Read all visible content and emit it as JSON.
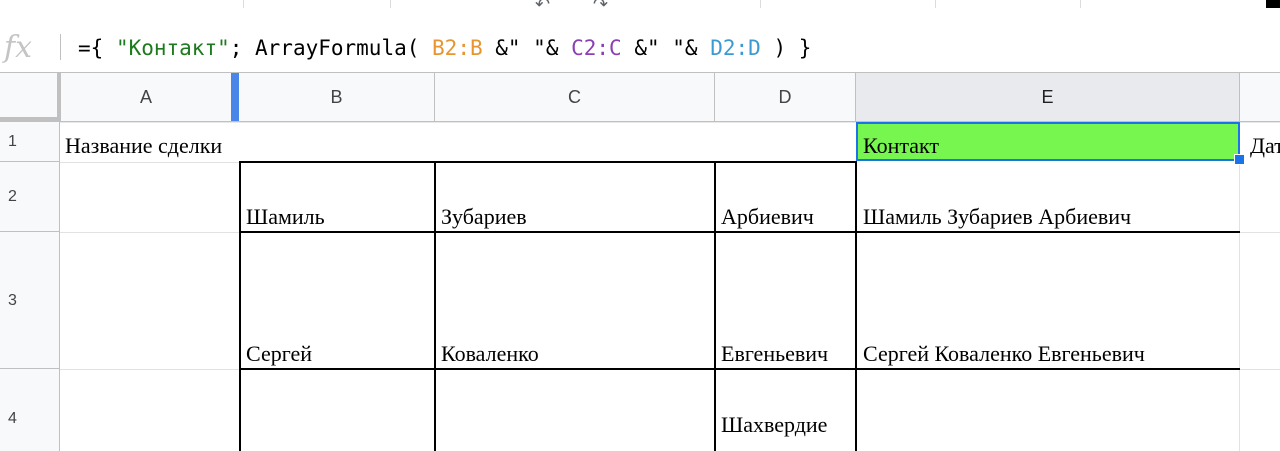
{
  "formula_bar": {
    "fx_label": "fx",
    "tokens": {
      "t1": "={ ",
      "t2": "\"Контакт\"",
      "t3": "; ArrayFormula( ",
      "t4": "B2:B",
      "t5": " &\" \"& ",
      "t6": "C2:C",
      "t7": " &\" \"& ",
      "t8": "D2:D",
      "t9": " ) }"
    }
  },
  "columns": {
    "a": "A",
    "b": "B",
    "c": "C",
    "d": "D",
    "e": "E"
  },
  "rows": {
    "r1": "1",
    "r2": "2",
    "r3": "3",
    "r4": "4"
  },
  "cells": {
    "a1": "Название сделки",
    "e1": "Контакт",
    "f1": "Дата",
    "b2": "Шамиль",
    "c2": "Зубариев",
    "d2": "Арбиевич",
    "e2": "Шамиль Зубариев Арбиевич",
    "b3": "Сергей",
    "c3": "Коваленко",
    "d3": "Евгеньевич",
    "e3": "Сергей Коваленко Евгеньевич",
    "d4": "Шахвердие"
  },
  "colors": {
    "selected_fill": "#76f64f",
    "selection_border": "#1a73e8",
    "range_b": "#e8952f",
    "range_c": "#8a3fb6",
    "range_d": "#3b9bd0",
    "string_literal": "#1e7a1e"
  }
}
